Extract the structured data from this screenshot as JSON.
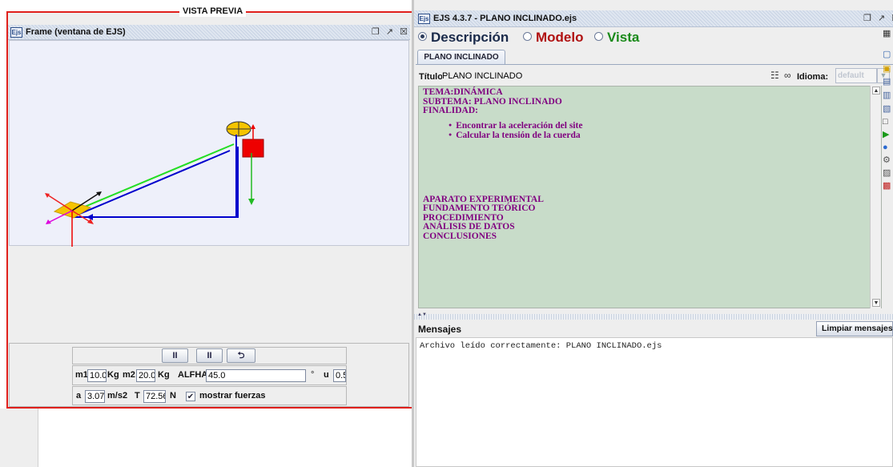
{
  "preview": {
    "label": "VISTA PREVIA",
    "frame_title": "Frame (ventana de EJS)",
    "icon_text": "Ejs",
    "buttons": {
      "play": "II",
      "pause": "II",
      "reset": "⮌"
    },
    "params": {
      "m1_label": "m1",
      "m1_value": "10.0",
      "m1_unit": "Kg",
      "m2_label": "m2",
      "m2_value": "20.0",
      "m2_unit": "Kg",
      "alfha_label": "ALFHA",
      "alfha_value": "45.0",
      "alfha_unit": "°",
      "u_label": "u",
      "u_value": "0.5"
    },
    "results": {
      "a_label": "a",
      "a_value": "3.07",
      "a_unit": "m/s2",
      "t_label": "T",
      "t_value": "72.56",
      "t_unit": "N",
      "show_forces_label": "mostrar fuerzas",
      "show_forces_checked": true
    }
  },
  "editor": {
    "window_title": "EJS 4.3.7 - PLANO INCLINADO.ejs",
    "icon_text": "Ejs",
    "modes": [
      {
        "label": "Descripción",
        "selected": true,
        "color": "#1a2a4a"
      },
      {
        "label": "Modelo",
        "selected": false,
        "color": "#b01010"
      },
      {
        "label": "Vista",
        "selected": false,
        "color": "#1a8a1a"
      }
    ],
    "tab_label": "PLANO INCLINADO",
    "titulo_label": "Título:",
    "titulo_value": "PLANO INCLINADO",
    "idioma_label": "Idioma:",
    "idioma_value": "default",
    "description": {
      "lines": [
        "TEMA:DINÁMICA",
        "SUBTEMA: PLANO INCLINADO",
        "FINALIDAD:"
      ],
      "bullets": [
        "Encontrar la aceleración del site",
        "Calcular la tensión de la cuerda"
      ],
      "sections": [
        "APARATO EXPERIMENTAL",
        "FUNDAMENTO TEÓRICO",
        "PROCEDIMIENTO",
        "ANÁLISIS DE DATOS",
        "CONCLUSIONES"
      ]
    },
    "messages_title": "Mensajes",
    "clear_button": "Limpiar mensajes",
    "message_log": "Archivo leído correctamente: PLANO INCLINADO.ejs"
  },
  "colors": {
    "preview_border": "#e0201c",
    "description_bg": "#c8dcc9",
    "description_text": "#800080"
  }
}
